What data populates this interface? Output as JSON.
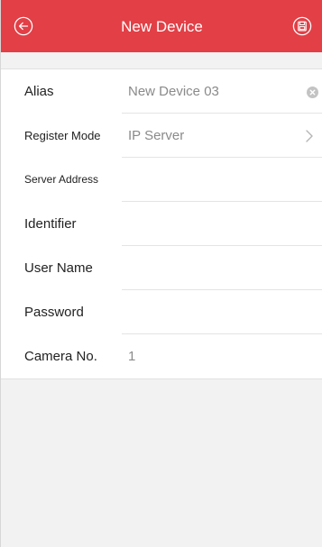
{
  "header": {
    "title": "New Device",
    "back_icon": "circle-arrow-left-icon",
    "save_icon": "circle-save-icon",
    "bg_color": "#e23f46"
  },
  "form": {
    "alias": {
      "label": "Alias",
      "value": "New Device 03"
    },
    "register_mode": {
      "label": "Register Mode",
      "value": "IP Server"
    },
    "server_address": {
      "label": "Server Address",
      "value": ""
    },
    "identifier": {
      "label": "Identifier",
      "value": ""
    },
    "user_name": {
      "label": "User Name",
      "value": ""
    },
    "password": {
      "label": "Password",
      "value": ""
    },
    "camera_no": {
      "label": "Camera No.",
      "value": "1"
    }
  }
}
